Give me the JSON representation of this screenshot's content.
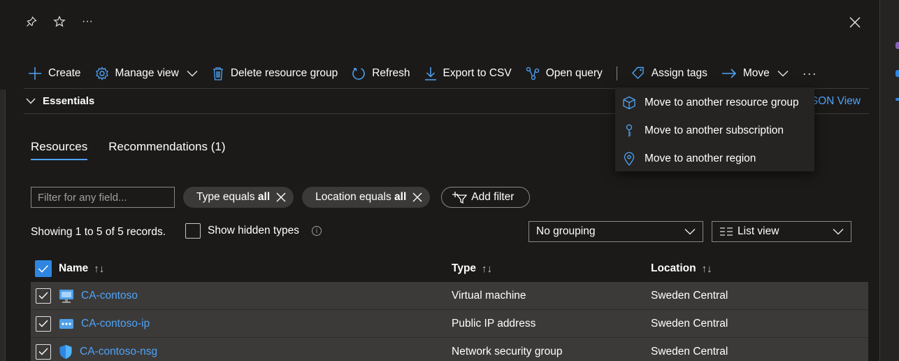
{
  "window": {
    "more_glyph": "···"
  },
  "toolbar": {
    "create": "Create",
    "manage_view": "Manage view",
    "delete_rg": "Delete resource group",
    "refresh": "Refresh",
    "export_csv": "Export to CSV",
    "open_query": "Open query",
    "assign_tags": "Assign tags",
    "move": "Move",
    "more": "···"
  },
  "essentials": {
    "label": "Essentials",
    "json_view_partial": "SON View"
  },
  "move_menu": {
    "items": [
      {
        "label": "Move to another resource group",
        "icon": "cube-icon"
      },
      {
        "label": "Move to another subscription",
        "icon": "key-icon"
      },
      {
        "label": "Move to another region",
        "icon": "location-pin-icon"
      }
    ]
  },
  "tabs": [
    {
      "label": "Resources",
      "active": true
    },
    {
      "label": "Recommendations (1)",
      "active": false
    }
  ],
  "filters": {
    "placeholder": "Filter for any field...",
    "type_prefix": "Type equals ",
    "type_value": "all",
    "location_prefix": "Location equals ",
    "location_value": "all",
    "add_filter": "Add filter"
  },
  "records_text": "Showing 1 to 5 of 5 records.",
  "show_hidden_types": "Show hidden types",
  "info_glyph": "i",
  "grouping": {
    "value": "No grouping"
  },
  "view_mode": {
    "value": "List view"
  },
  "table": {
    "columns": {
      "name": "Name",
      "type": "Type",
      "location": "Location"
    },
    "sort_glyph": "↑↓",
    "rows": [
      {
        "name": "CA-contoso",
        "type": "Virtual machine",
        "location": "Sweden Central",
        "icon": "virtual-machine-icon"
      },
      {
        "name": "CA-contoso-ip",
        "type": "Public IP address",
        "location": "Sweden Central",
        "icon": "public-ip-icon"
      },
      {
        "name": "CA-contoso-nsg",
        "type": "Network security group",
        "location": "Sweden Central",
        "icon": "nsg-shield-icon"
      }
    ]
  },
  "colors": {
    "accent": "#4fa3f7",
    "checkbox": "#2f86e0",
    "row_bg": "#3b3a39",
    "page_bg": "#1b1a19"
  }
}
